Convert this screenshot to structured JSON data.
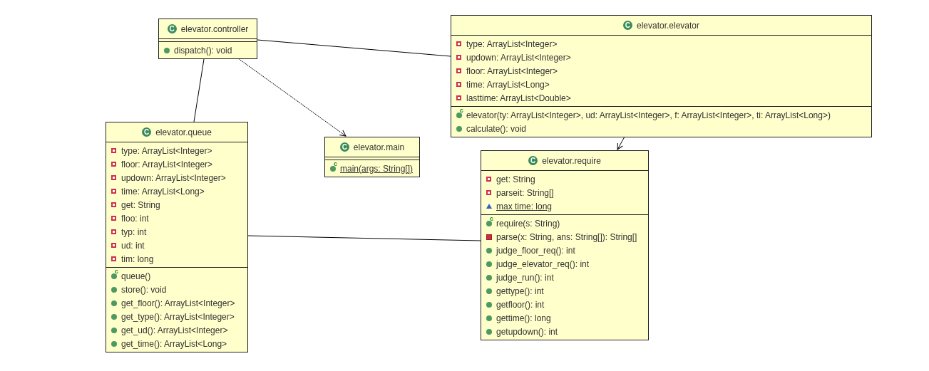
{
  "classes": [
    {
      "name": "elevator.controller",
      "icon_letter": "C",
      "methods": [
        {
          "kind": "public",
          "text": "dispatch(): void",
          "static": false
        }
      ]
    },
    {
      "name": "elevator.elevator",
      "icon_letter": "C",
      "attributes": [
        {
          "kind": "private",
          "text": "type: ArrayList<Integer>",
          "static": false
        },
        {
          "kind": "private",
          "text": "updown: ArrayList<Integer>",
          "static": false
        },
        {
          "kind": "private",
          "text": "floor: ArrayList<Integer>",
          "static": false
        },
        {
          "kind": "private",
          "text": "time: ArrayList<Long>",
          "static": false
        },
        {
          "kind": "private",
          "text": "lasttime: ArrayList<Double>",
          "static": false
        }
      ],
      "methods": [
        {
          "kind": "constructor",
          "badge": "c",
          "text": "elevator(ty: ArrayList<Integer>, ud: ArrayList<Integer>, f: ArrayList<Integer>, ti: ArrayList<Long>)",
          "static": false
        },
        {
          "kind": "public",
          "text": "calculate(): void",
          "static": false
        }
      ]
    },
    {
      "name": "elevator.queue",
      "icon_letter": "C",
      "attributes": [
        {
          "kind": "private",
          "text": "type: ArrayList<Integer>",
          "static": false
        },
        {
          "kind": "private",
          "text": "floor: ArrayList<Integer>",
          "static": false
        },
        {
          "kind": "private",
          "text": "updown: ArrayList<Integer>",
          "static": false
        },
        {
          "kind": "private",
          "text": "time: ArrayList<Long>",
          "static": false
        },
        {
          "kind": "private",
          "text": "get: String",
          "static": false
        },
        {
          "kind": "private",
          "text": "floo: int",
          "static": false
        },
        {
          "kind": "private",
          "text": "typ: int",
          "static": false
        },
        {
          "kind": "private",
          "text": "ud: int",
          "static": false
        },
        {
          "kind": "private",
          "text": "tim: long",
          "static": false
        }
      ],
      "methods": [
        {
          "kind": "constructor",
          "badge": "c",
          "text": "queue()",
          "static": false
        },
        {
          "kind": "public",
          "text": "store(): void",
          "static": false
        },
        {
          "kind": "public",
          "text": "get_floor(): ArrayList<Integer>",
          "static": false
        },
        {
          "kind": "public",
          "text": "get_type(): ArrayList<Integer>",
          "static": false
        },
        {
          "kind": "public",
          "text": "get_ud(): ArrayList<Integer>",
          "static": false
        },
        {
          "kind": "public",
          "text": "get_time(): ArrayList<Long>",
          "static": false
        }
      ]
    },
    {
      "name": "elevator.main",
      "icon_letter": "C",
      "methods": [
        {
          "kind": "constructor",
          "badge": "c",
          "text": "main(args: String[])",
          "static": true
        }
      ]
    },
    {
      "name": "elevator.require",
      "icon_letter": "C",
      "attributes": [
        {
          "kind": "private",
          "text": "get: String",
          "static": false
        },
        {
          "kind": "private",
          "text": "parseit: String[]",
          "static": false
        },
        {
          "kind": "package",
          "text": "max time: long",
          "static": true
        }
      ],
      "methods": [
        {
          "kind": "constructor",
          "badge": "c",
          "text": "require(s: String)",
          "static": false
        },
        {
          "kind": "private_method",
          "text": "parse(x: String, ans: String[]): String[]",
          "static": false
        },
        {
          "kind": "public",
          "text": "judge_floor_req(): int",
          "static": false
        },
        {
          "kind": "public",
          "text": "judge_elevator_req(): int",
          "static": false
        },
        {
          "kind": "public",
          "text": "judge_run(): int",
          "static": false
        },
        {
          "kind": "public",
          "text": "gettype(): int",
          "static": false
        },
        {
          "kind": "public",
          "text": "getfloor(): int",
          "static": false
        },
        {
          "kind": "public",
          "text": "gettime(): long",
          "static": false
        },
        {
          "kind": "public",
          "text": "getupdown(): int",
          "static": false
        }
      ]
    }
  ]
}
